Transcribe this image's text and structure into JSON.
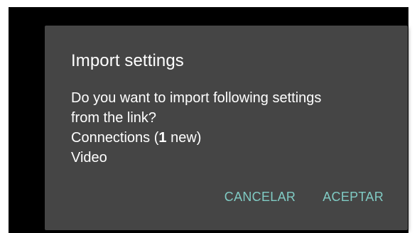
{
  "dialog": {
    "title": "Import settings",
    "message_line1": "Do you want to import following settings",
    "message_line2": "from the link?",
    "connections_prefix": "Connections (",
    "connections_count": "1",
    "connections_suffix": " new)",
    "video_label": "Video",
    "cancel_label": "CANCELAR",
    "accept_label": "ACEPTAR"
  },
  "colors": {
    "screen_bg": "#000000",
    "dialog_bg": "#454545",
    "text": "#ffffff",
    "accent": "#80cbc4"
  }
}
